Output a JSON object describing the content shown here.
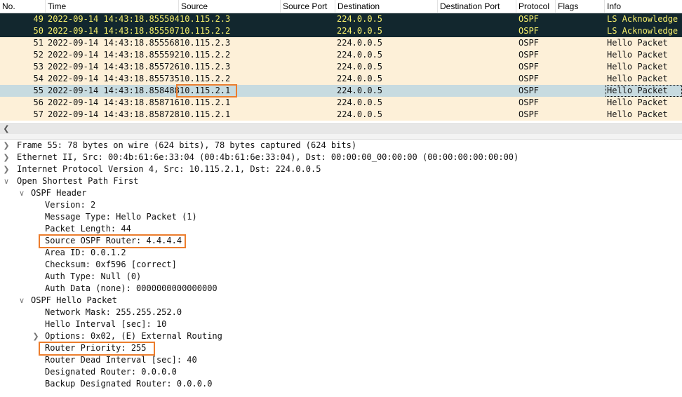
{
  "packet_list": {
    "columns": [
      "No.",
      "Time",
      "Source",
      "Source Port",
      "Destination",
      "Destination Port",
      "Protocol",
      "Flags",
      "Info"
    ],
    "rows": [
      {
        "no": "49",
        "time": "2022-09-14 14:43:18.855504",
        "source": "10.115.2.3",
        "destination": "224.0.0.5",
        "protocol": "OSPF",
        "info": "LS Acknowledge",
        "style": "dark"
      },
      {
        "no": "50",
        "time": "2022-09-14 14:43:18.855507",
        "source": "10.115.2.2",
        "destination": "224.0.0.5",
        "protocol": "OSPF",
        "info": "LS Acknowledge",
        "style": "dark"
      },
      {
        "no": "51",
        "time": "2022-09-14 14:43:18.855568",
        "source": "10.115.2.3",
        "destination": "224.0.0.5",
        "protocol": "OSPF",
        "info": "Hello Packet",
        "style": "normal"
      },
      {
        "no": "52",
        "time": "2022-09-14 14:43:18.855592",
        "source": "10.115.2.2",
        "destination": "224.0.0.5",
        "protocol": "OSPF",
        "info": "Hello Packet",
        "style": "normal"
      },
      {
        "no": "53",
        "time": "2022-09-14 14:43:18.855726",
        "source": "10.115.2.3",
        "destination": "224.0.0.5",
        "protocol": "OSPF",
        "info": "Hello Packet",
        "style": "normal"
      },
      {
        "no": "54",
        "time": "2022-09-14 14:43:18.855735",
        "source": "10.115.2.2",
        "destination": "224.0.0.5",
        "protocol": "OSPF",
        "info": "Hello Packet",
        "style": "normal"
      },
      {
        "no": "55",
        "time": "2022-09-14 14:43:18.858488",
        "source": "10.115.2.1",
        "destination": "224.0.0.5",
        "protocol": "OSPF",
        "info": "Hello Packet",
        "style": "selected"
      },
      {
        "no": "56",
        "time": "2022-09-14 14:43:18.858716",
        "source": "10.115.2.1",
        "destination": "224.0.0.5",
        "protocol": "OSPF",
        "info": "Hello Packet",
        "style": "normal"
      },
      {
        "no": "57",
        "time": "2022-09-14 14:43:18.858728",
        "source": "10.115.2.1",
        "destination": "224.0.0.5",
        "protocol": "OSPF",
        "info": "Hello Packet",
        "style": "normal"
      }
    ]
  },
  "scroll": {
    "left_arrow_icon": "chevron-left-icon"
  },
  "details": {
    "frame": "Frame 55: 78 bytes on wire (624 bits), 78 bytes captured (624 bits)",
    "ethernet": "Ethernet II, Src: 00:4b:61:6e:33:04 (00:4b:61:6e:33:04), Dst: 00:00:00_00:00:00 (00:00:00:00:00:00)",
    "ip": "Internet Protocol Version 4, Src: 10.115.2.1, Dst: 224.0.0.5",
    "ospf": "Open Shortest Path First",
    "ospf_header": "OSPF Header",
    "version": "Version: 2",
    "message_type": "Message Type: Hello Packet (1)",
    "packet_length": "Packet Length: 44",
    "source_router": "Source OSPF Router: 4.4.4.4",
    "area_id": "Area ID: 0.0.1.2",
    "checksum": "Checksum: 0xf596 [correct]",
    "auth_type": "Auth Type: Null (0)",
    "auth_data": "Auth Data (none): 0000000000000000",
    "hello_packet": "OSPF Hello Packet",
    "network_mask": "Network Mask: 255.255.252.0",
    "hello_interval": "Hello Interval [sec]: 10",
    "options": "Options: 0x02, (E) External Routing",
    "router_priority": "Router Priority: 255",
    "dead_interval": "Router Dead Interval [sec]: 40",
    "designated_router": "Designated Router: 0.0.0.0",
    "backup_dr": "Backup Designated Router: 0.0.0.0"
  },
  "colors": {
    "highlight_border": "#ec7d2d",
    "row_normal_bg": "#fdf0d8",
    "row_dark_bg": "#12272e",
    "row_dark_fg": "#f7f06c",
    "row_selected_bg": "#c7dbe0"
  }
}
